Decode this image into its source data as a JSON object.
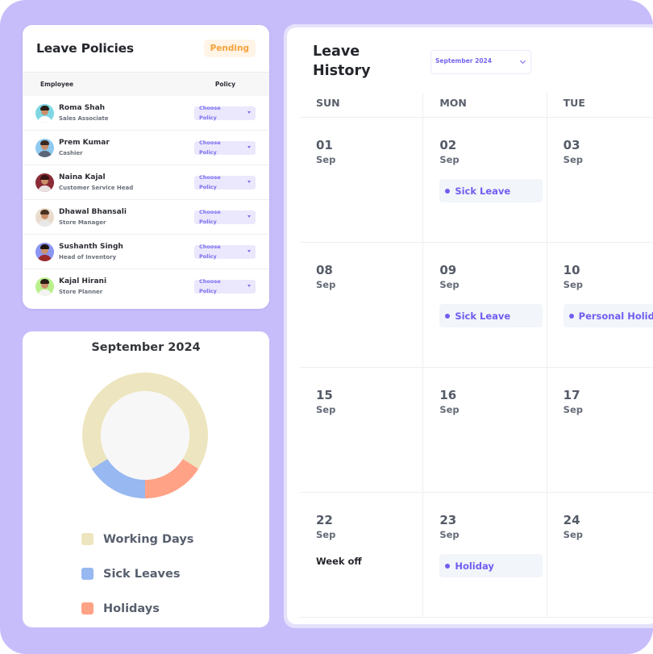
{
  "leave_policies": {
    "title": "Leave Policies",
    "status_badge": "Pending",
    "columns": {
      "employee": "Employee",
      "policy": "Policy"
    },
    "employees": [
      {
        "name": "Roma Shah",
        "role": "Sales Associate",
        "policy_placeholder": "Choose Policy",
        "avatar_bg": "#7fd7e3",
        "avatar_body": "#ffffff",
        "avatar_hair": "#2a1d16"
      },
      {
        "name": "Prem Kumar",
        "role": "Cashier",
        "policy_placeholder": "Choose Policy",
        "avatar_bg": "#8ec9f0",
        "avatar_body": "#5b6678",
        "avatar_hair": "#3b2a20"
      },
      {
        "name": "Naina Kajal",
        "role": "Customer Service Head",
        "policy_placeholder": "Choose Policy",
        "avatar_bg": "#8a2b36",
        "avatar_body": "#e9e2e0",
        "avatar_hair": "#3a1412"
      },
      {
        "name": "Dhawal Bhansali",
        "role": "Store Manager",
        "policy_placeholder": "Choose Policy",
        "avatar_bg": "#eadccd",
        "avatar_body": "#e8e8e8",
        "avatar_hair": "#4a3220"
      },
      {
        "name": "Sushanth Singh",
        "role": "Head of Inventory",
        "policy_placeholder": "Choose Policy",
        "avatar_bg": "#8b95f2",
        "avatar_body": "#9b2a2a",
        "avatar_hair": "#1d1410"
      },
      {
        "name": "Kajal Hirani",
        "role": "Store Planner",
        "policy_placeholder": "Choose Policy",
        "avatar_bg": "#b9f08c",
        "avatar_body": "#f3f3f3",
        "avatar_hair": "#2a1d16"
      }
    ]
  },
  "chart_data": {
    "type": "pie",
    "title": "September 2024",
    "donut": true,
    "legend_position": "bottom",
    "categories": [
      "Working Days",
      "Sick Leaves",
      "Holidays"
    ],
    "values": [
      21,
      5,
      5
    ],
    "colors": [
      "#ede5bf",
      "#97b8f0",
      "#ffa286"
    ],
    "center_color": "#f7f7f8"
  },
  "leave_history": {
    "title": "Leave History",
    "month_select": {
      "value": "September 2024"
    },
    "day_names": [
      "SUN",
      "MON",
      "TUE"
    ],
    "weeks": [
      [
        {
          "day": "01",
          "month": "Sep"
        },
        {
          "day": "02",
          "month": "Sep",
          "event": "Sick Leave"
        },
        {
          "day": "03",
          "month": "Sep"
        }
      ],
      [
        {
          "day": "08",
          "month": "Sep"
        },
        {
          "day": "09",
          "month": "Sep",
          "event": "Sick Leave"
        },
        {
          "day": "10",
          "month": "Sep",
          "event": "Personal Holiday"
        }
      ],
      [
        {
          "day": "15",
          "month": "Sep"
        },
        {
          "day": "16",
          "month": "Sep"
        },
        {
          "day": "17",
          "month": "Sep"
        }
      ],
      [
        {
          "day": "22",
          "month": "Sep",
          "note": "Week off"
        },
        {
          "day": "23",
          "month": "Sep",
          "event": "Holiday"
        },
        {
          "day": "24",
          "month": "Sep"
        }
      ]
    ],
    "event_color": "#6f5ef0"
  }
}
